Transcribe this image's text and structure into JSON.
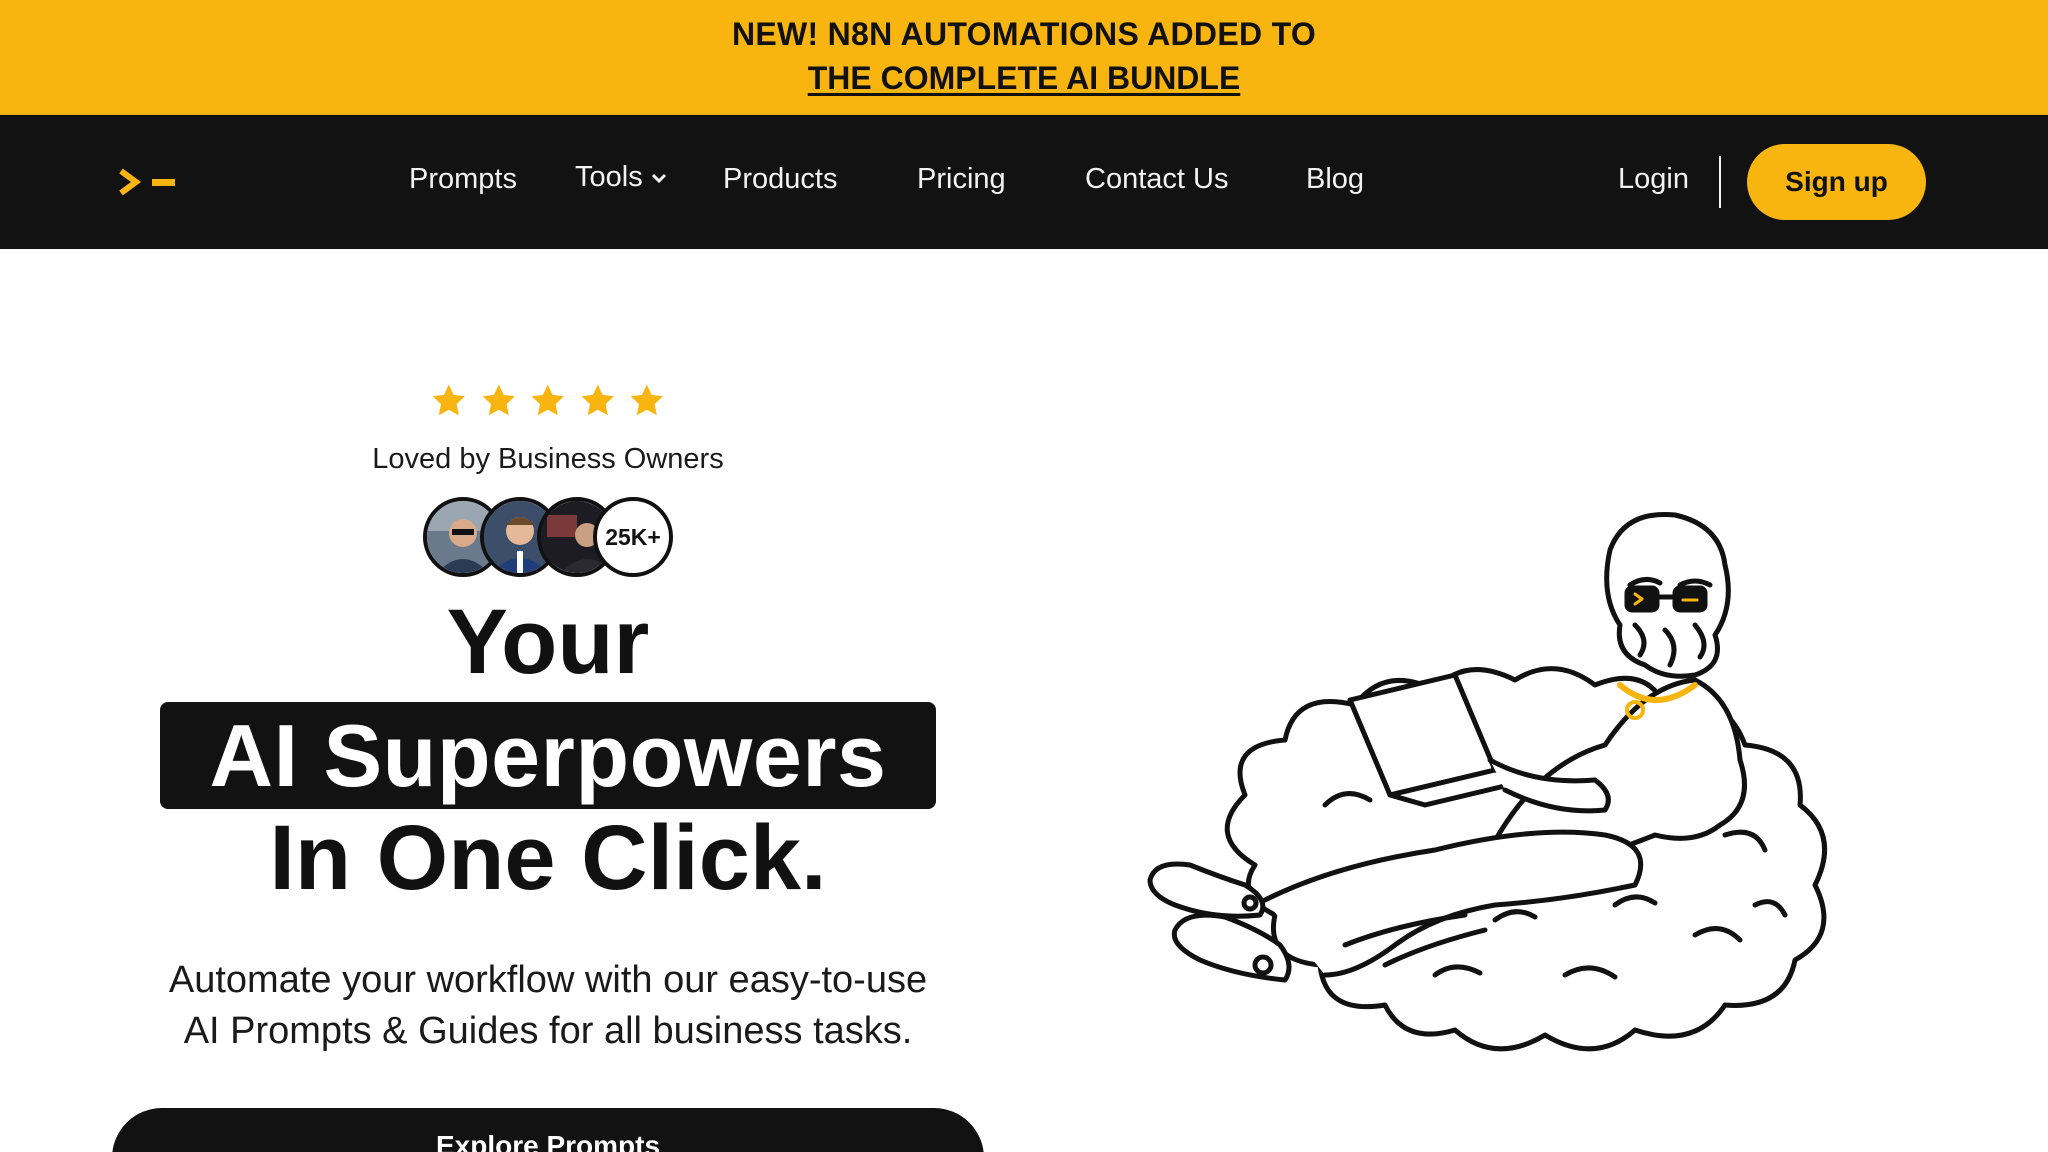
{
  "announcement": {
    "line1": "NEW! N8N AUTOMATIONS ADDED TO",
    "link": "THE COMPLETE AI BUNDLE"
  },
  "nav": {
    "items": [
      {
        "label": "Prompts"
      },
      {
        "label": "Tools",
        "icon": "chevron-down-icon"
      },
      {
        "label": "Products"
      },
      {
        "label": "Pricing"
      },
      {
        "label": "Contact Us"
      },
      {
        "label": "Blog"
      }
    ],
    "login": "Login",
    "signup": "Sign up"
  },
  "hero": {
    "rating": 5,
    "loved_by": "Loved by Business Owners",
    "user_count": "25K+",
    "heading_line1": "Your",
    "heading_highlight": "AI Superpowers",
    "heading_line3": "In One Click.",
    "subtext_line1": "Automate your workflow with our easy-to-use",
    "subtext_line2": "AI Prompts & Guides for all business tasks.",
    "cta": "Explore Prompts"
  },
  "colors": {
    "accent": "#F8B50F",
    "dark": "#121212",
    "background": "#FFFFFF"
  }
}
